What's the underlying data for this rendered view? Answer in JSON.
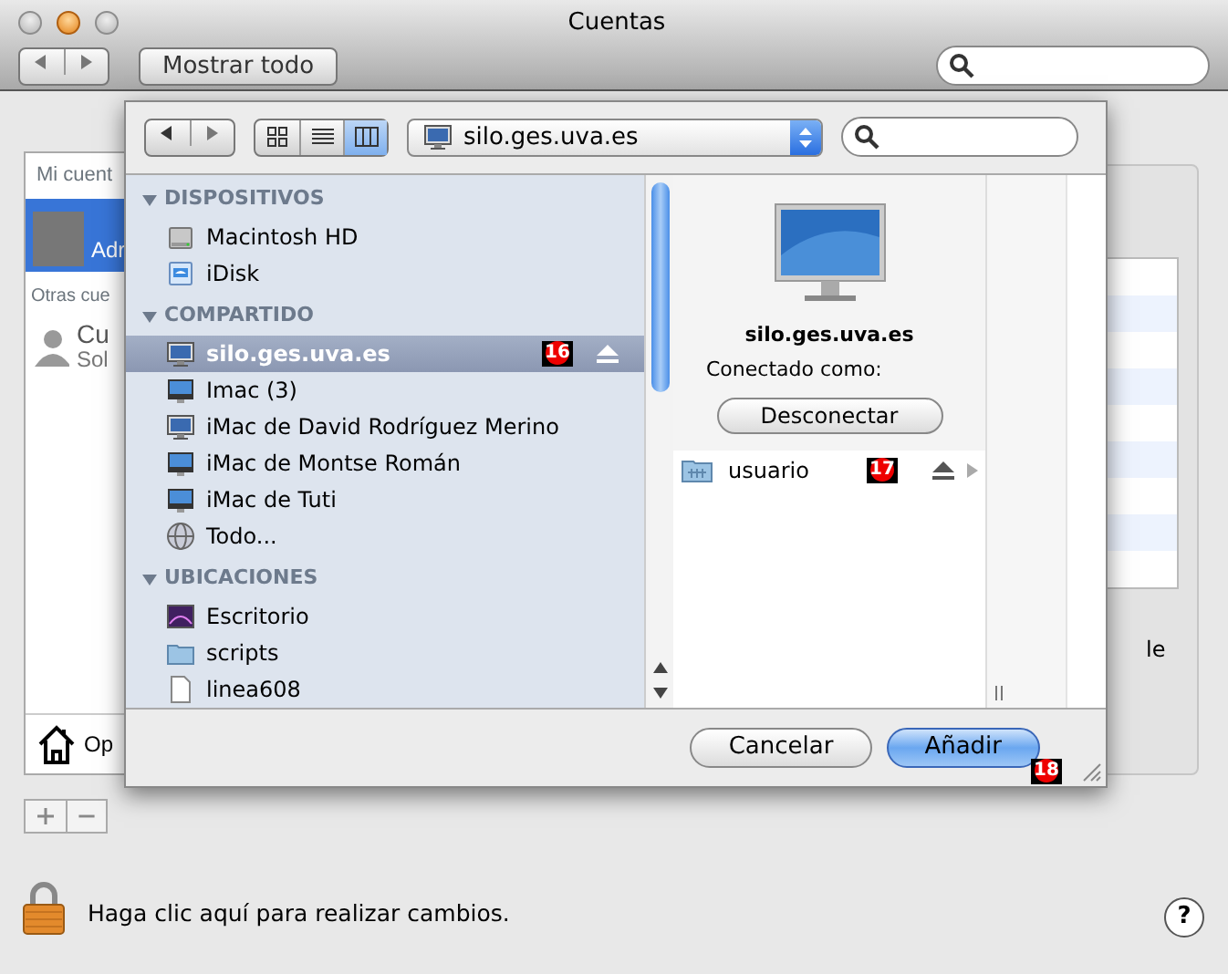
{
  "window": {
    "title": "Cuentas",
    "show_all_button": "Mostrar todo"
  },
  "accounts_panel": {
    "my_account_header": "Mi cuent",
    "my_account_name": "Adr",
    "other_header": "Otras cue",
    "other_name": "Cu",
    "other_sub": "Sol",
    "login_options": "Op"
  },
  "behind_text": "le",
  "lock_text": "Haga clic aquí para realizar cambios.",
  "help_button": "?",
  "sheet": {
    "location": "silo.ges.uva.es",
    "views": [
      {
        "kind": "icons",
        "selected": false
      },
      {
        "kind": "list",
        "selected": false
      },
      {
        "kind": "columns",
        "selected": true
      }
    ],
    "sidebar": [
      {
        "title": "DISPOSITIVOS",
        "expanded": true,
        "items": [
          {
            "label": "Macintosh HD",
            "kind": "disk",
            "selected": false,
            "eject": false
          },
          {
            "label": "iDisk",
            "kind": "idisk",
            "selected": false,
            "eject": false
          }
        ]
      },
      {
        "title": "COMPARTIDO",
        "expanded": true,
        "items": [
          {
            "label": "silo.ges.uva.es",
            "kind": "display",
            "selected": true,
            "eject": true,
            "marker": "16"
          },
          {
            "label": "Imac (3)",
            "kind": "imac",
            "selected": false,
            "eject": false
          },
          {
            "label": "iMac de David Rodríguez Merino",
            "kind": "display",
            "selected": false,
            "eject": false
          },
          {
            "label": "iMac de Montse Román",
            "kind": "imac",
            "selected": false,
            "eject": false
          },
          {
            "label": "iMac de Tuti",
            "kind": "imac",
            "selected": false,
            "eject": false
          },
          {
            "label": "Todo...",
            "kind": "globe",
            "selected": false,
            "eject": false
          }
        ]
      },
      {
        "title": "UBICACIONES",
        "expanded": true,
        "items": [
          {
            "label": "Escritorio",
            "kind": "desktop",
            "selected": false,
            "eject": false
          },
          {
            "label": "scripts",
            "kind": "folder",
            "selected": false,
            "eject": false
          },
          {
            "label": "linea608",
            "kind": "document",
            "selected": false,
            "eject": false
          }
        ]
      }
    ],
    "detail": {
      "name": "silo.ges.uva.es",
      "connected_as": "Conectado como:",
      "disconnect_button": "Desconectar",
      "items": [
        {
          "label": "usuario",
          "eject": true,
          "marker": "17"
        }
      ]
    },
    "buttons": [
      {
        "label": "Cancelar",
        "default": false
      },
      {
        "label": "Añadir",
        "default": true,
        "marker": "18"
      }
    ]
  }
}
